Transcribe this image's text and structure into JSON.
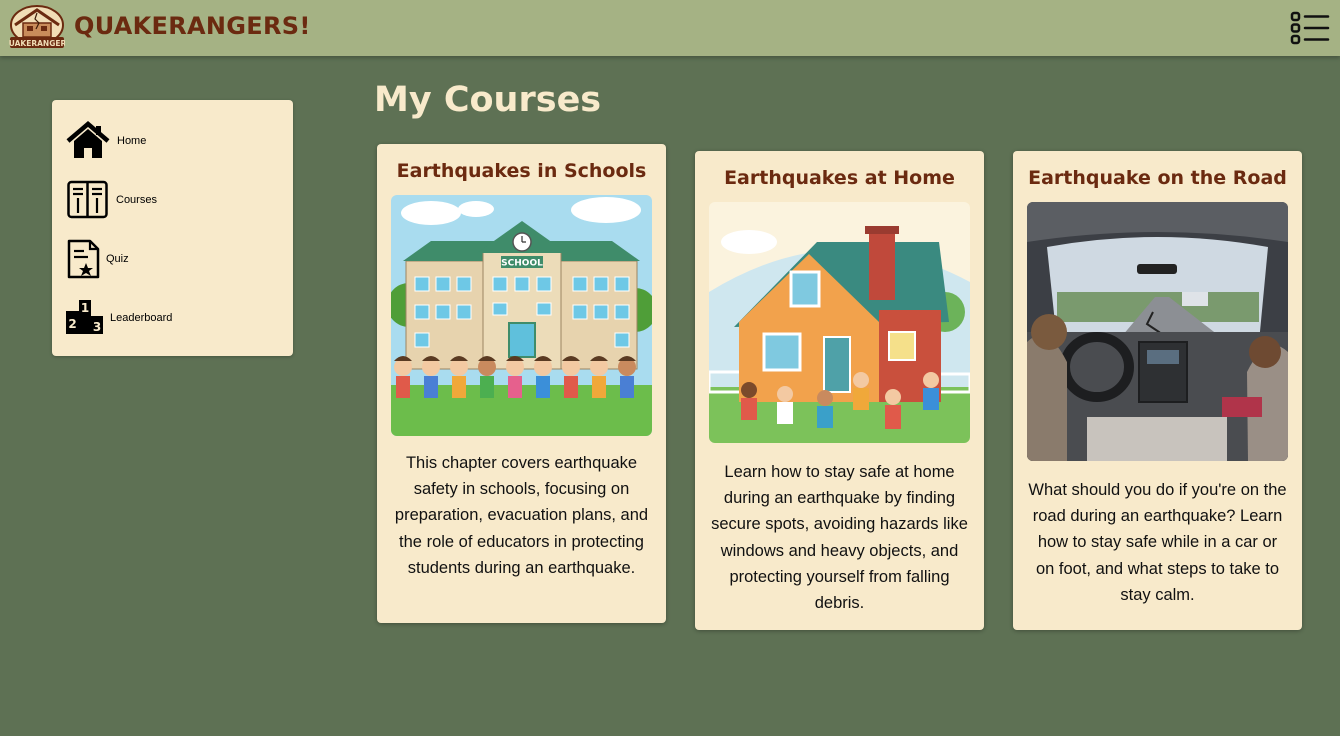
{
  "header": {
    "brand": "QUAKERANGERS!",
    "logo_text": "QUAKERANGERS",
    "logo_icon": "house-crack-logo",
    "menu_icon": "list-menu-icon"
  },
  "sidebar": {
    "items": [
      {
        "label": "Home",
        "icon": "home-icon"
      },
      {
        "label": "Courses",
        "icon": "book-icon"
      },
      {
        "label": "Quiz",
        "icon": "quiz-icon"
      },
      {
        "label": "Leaderboard",
        "icon": "podium-icon"
      }
    ]
  },
  "main": {
    "title": "My Courses",
    "courses": [
      {
        "title": "Earthquakes in Schools",
        "image_sign": "SCHOOL",
        "description": "This chapter covers earthquake safety in schools, focusing on preparation, evacuation plans, and the role of educators in protecting students during an earthquake."
      },
      {
        "title": "Earthquakes at Home",
        "description": "Learn how to stay safe at home during an earthquake by finding secure spots, avoiding hazards like windows and heavy objects, and protecting yourself from falling debris."
      },
      {
        "title": "Earthquake on the Road",
        "description": "What should you do if you're on the road during an earthquake? Learn how to stay safe while in a car or on foot, and what steps to take to stay calm."
      }
    ]
  },
  "colors": {
    "background": "#5e7154",
    "header": "#a5b284",
    "card": "#f8eacb",
    "title_brown": "#6b2a10",
    "page_title": "#f8eacb"
  }
}
